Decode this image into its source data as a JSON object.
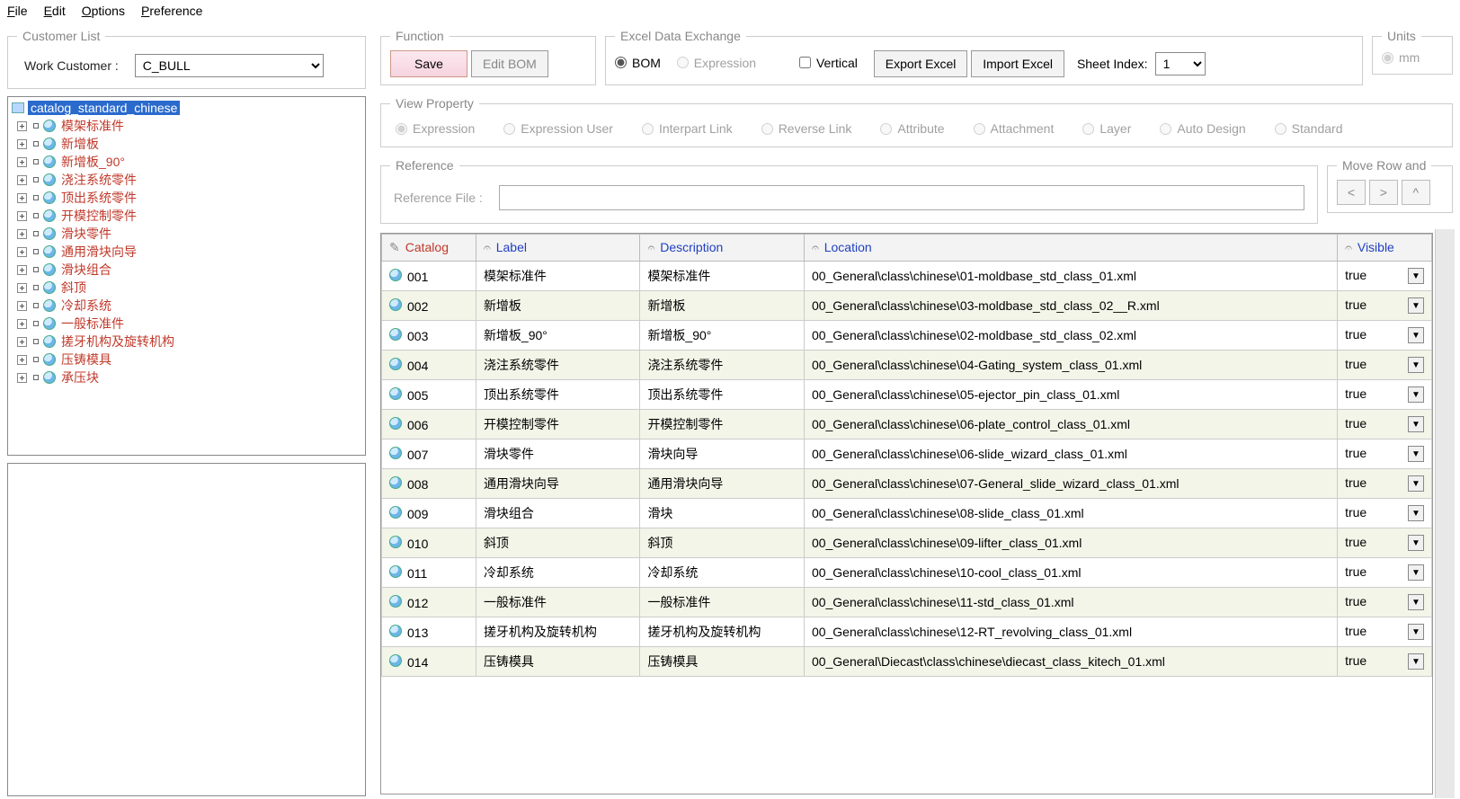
{
  "menubar": [
    "File",
    "Edit",
    "Options",
    "Preference"
  ],
  "customer": {
    "legend": "Customer List",
    "label": "Work Customer :",
    "value": "C_BULL"
  },
  "function_group": {
    "legend": "Function",
    "save": "Save",
    "edit_bom": "Edit BOM"
  },
  "excel": {
    "legend": "Excel Data Exchange",
    "bom": "BOM",
    "expression": "Expression",
    "vertical": "Vertical",
    "export": "Export Excel",
    "import": "Import Excel",
    "sheet_label": "Sheet Index:",
    "sheet_value": "1"
  },
  "units": {
    "legend": "Units",
    "mm": "mm"
  },
  "view_property": {
    "legend": "View Property",
    "options": [
      "Expression",
      "Expression User",
      "Interpart Link",
      "Reverse Link",
      "Attribute",
      "Attachment",
      "Layer",
      "Auto Design",
      "Standard"
    ]
  },
  "reference": {
    "legend": "Reference",
    "label": "Reference File :",
    "value": ""
  },
  "move_row": {
    "legend": "Move Row and",
    "prev": "<",
    "next": ">",
    "up": "^"
  },
  "tree": {
    "root": "catalog_standard_chinese",
    "items": [
      "模架标准件",
      "新增板",
      "新增板_90°",
      "浇注系统零件",
      "顶出系统零件",
      "开模控制零件",
      "滑块零件",
      "通用滑块向导",
      "滑块组合",
      "斜顶",
      "冷却系统",
      "一般标准件",
      "搓牙机构及旋转机构",
      "压铸模具",
      "承压块"
    ]
  },
  "table": {
    "headers": {
      "catalog": "Catalog",
      "label": "Label",
      "description": "Description",
      "location": "Location",
      "visible": "Visible"
    },
    "rows": [
      {
        "catalog": "001",
        "label": "模架标准件",
        "description": "模架标准件",
        "location": "00_General\\class\\chinese\\01-moldbase_std_class_01.xml",
        "visible": "true"
      },
      {
        "catalog": "002",
        "label": "新增板",
        "description": "新增板",
        "location": "00_General\\class\\chinese\\03-moldbase_std_class_02__R.xml",
        "visible": "true"
      },
      {
        "catalog": "003",
        "label": "新增板_90°",
        "description": "新增板_90°",
        "location": "00_General\\class\\chinese\\02-moldbase_std_class_02.xml",
        "visible": "true"
      },
      {
        "catalog": "004",
        "label": "浇注系统零件",
        "description": "浇注系统零件",
        "location": "00_General\\class\\chinese\\04-Gating_system_class_01.xml",
        "visible": "true"
      },
      {
        "catalog": "005",
        "label": "顶出系统零件",
        "description": "顶出系统零件",
        "location": "00_General\\class\\chinese\\05-ejector_pin_class_01.xml",
        "visible": "true"
      },
      {
        "catalog": "006",
        "label": "开模控制零件",
        "description": "开模控制零件",
        "location": "00_General\\class\\chinese\\06-plate_control_class_01.xml",
        "visible": "true"
      },
      {
        "catalog": "007",
        "label": "滑块零件",
        "description": "滑块向导",
        "location": "00_General\\class\\chinese\\06-slide_wizard_class_01.xml",
        "visible": "true"
      },
      {
        "catalog": "008",
        "label": "通用滑块向导",
        "description": "通用滑块向导",
        "location": "00_General\\class\\chinese\\07-General_slide_wizard_class_01.xml",
        "visible": "true"
      },
      {
        "catalog": "009",
        "label": "滑块组合",
        "description": "滑块",
        "location": "00_General\\class\\chinese\\08-slide_class_01.xml",
        "visible": "true"
      },
      {
        "catalog": "010",
        "label": "斜顶",
        "description": "斜顶",
        "location": "00_General\\class\\chinese\\09-lifter_class_01.xml",
        "visible": "true"
      },
      {
        "catalog": "011",
        "label": "冷却系统",
        "description": "冷却系统",
        "location": "00_General\\class\\chinese\\10-cool_class_01.xml",
        "visible": "true"
      },
      {
        "catalog": "012",
        "label": "一般标准件",
        "description": "一般标准件",
        "location": "00_General\\class\\chinese\\11-std_class_01.xml",
        "visible": "true"
      },
      {
        "catalog": "013",
        "label": "搓牙机构及旋转机构",
        "description": "搓牙机构及旋转机构",
        "location": "00_General\\class\\chinese\\12-RT_revolving_class_01.xml",
        "visible": "true"
      },
      {
        "catalog": "014",
        "label": "压铸模具",
        "description": "压铸模具",
        "location": "00_General\\Diecast\\class\\chinese\\diecast_class_kitech_01.xml",
        "visible": "true"
      }
    ]
  }
}
